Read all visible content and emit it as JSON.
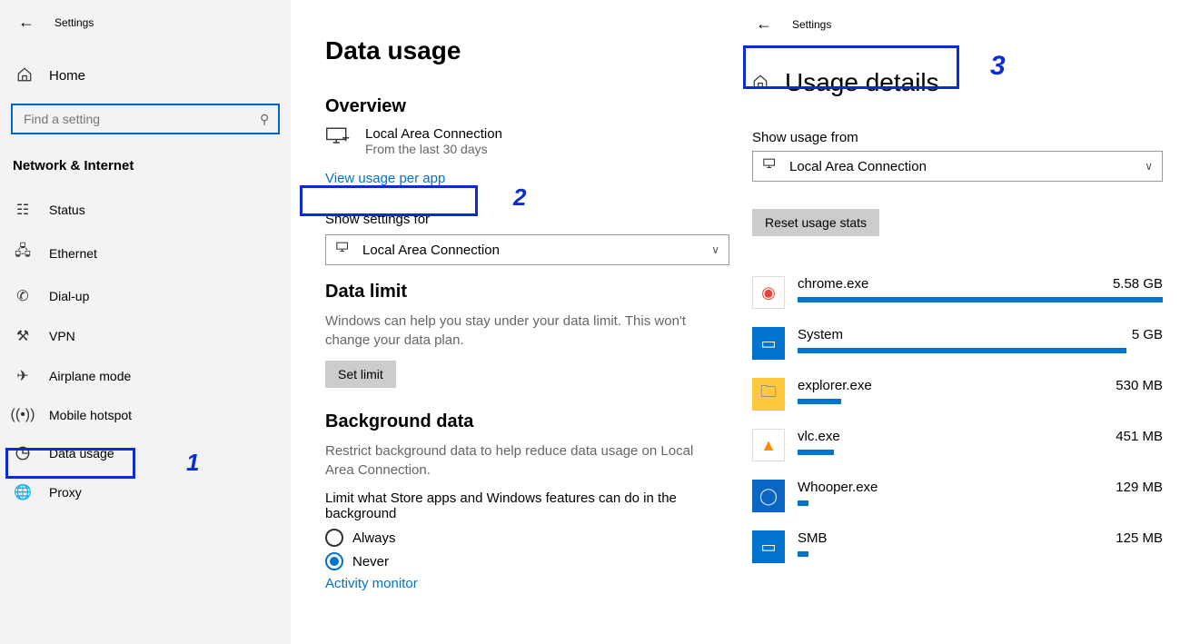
{
  "sidebar": {
    "settings_label": "Settings",
    "home_label": "Home",
    "search_placeholder": "Find a setting",
    "section_title": "Network & Internet",
    "items": [
      {
        "label": "Status",
        "icon": "status-icon"
      },
      {
        "label": "Ethernet",
        "icon": "ethernet-icon"
      },
      {
        "label": "Dial-up",
        "icon": "dialup-icon"
      },
      {
        "label": "VPN",
        "icon": "vpn-icon"
      },
      {
        "label": "Airplane mode",
        "icon": "airplane-icon"
      },
      {
        "label": "Mobile hotspot",
        "icon": "hotspot-icon"
      },
      {
        "label": "Data usage",
        "icon": "datausage-icon"
      },
      {
        "label": "Proxy",
        "icon": "proxy-icon"
      }
    ]
  },
  "main": {
    "title": "Data usage",
    "overview_h": "Overview",
    "conn_name": "Local Area Connection",
    "conn_sub": "From the last 30 days",
    "view_link": "View usage per app",
    "show_settings_label": "Show settings for",
    "show_settings_value": "Local Area Connection",
    "data_limit_h": "Data limit",
    "data_limit_desc": "Windows can help you stay under your data limit. This won't change your data plan.",
    "set_limit_btn": "Set limit",
    "bg_h": "Background data",
    "bg_desc": "Restrict background data to help reduce data usage on Local Area Connection.",
    "bg_limit_label": "Limit what Store apps and Windows features can do in the background",
    "opt_always": "Always",
    "opt_never": "Never",
    "activity_link": "Activity monitor"
  },
  "right": {
    "settings_label": "Settings",
    "title": "Usage details",
    "show_label": "Show usage from",
    "show_value": "Local Area Connection",
    "reset_btn": "Reset usage stats",
    "apps": [
      {
        "name": "chrome.exe",
        "amount": "5.58 GB",
        "pct": 100,
        "bg": "#fff",
        "glyph": "◉",
        "gcolor": "#ea4335",
        "border": "1px solid #ddd"
      },
      {
        "name": "System",
        "amount": "5 GB",
        "pct": 90,
        "bg": "#0073cf",
        "glyph": "▭",
        "gcolor": "#fff",
        "border": "none"
      },
      {
        "name": "explorer.exe",
        "amount": "530 MB",
        "pct": 12,
        "bg": "#ffc83d",
        "glyph": "🗀",
        "gcolor": "#0a66c2",
        "border": "none"
      },
      {
        "name": "vlc.exe",
        "amount": "451 MB",
        "pct": 10,
        "bg": "#fff",
        "glyph": "▲",
        "gcolor": "#ff8c00",
        "border": "1px solid #ddd"
      },
      {
        "name": "Whooper.exe",
        "amount": "129 MB",
        "pct": 3,
        "bg": "#0a66c2",
        "glyph": "◯",
        "gcolor": "#cfe8ff",
        "border": "none"
      },
      {
        "name": "SMB",
        "amount": "125 MB",
        "pct": 3,
        "bg": "#0073cf",
        "glyph": "▭",
        "gcolor": "#fff",
        "border": "none"
      }
    ]
  },
  "annotations": {
    "one": "1",
    "two": "2",
    "three": "3"
  }
}
